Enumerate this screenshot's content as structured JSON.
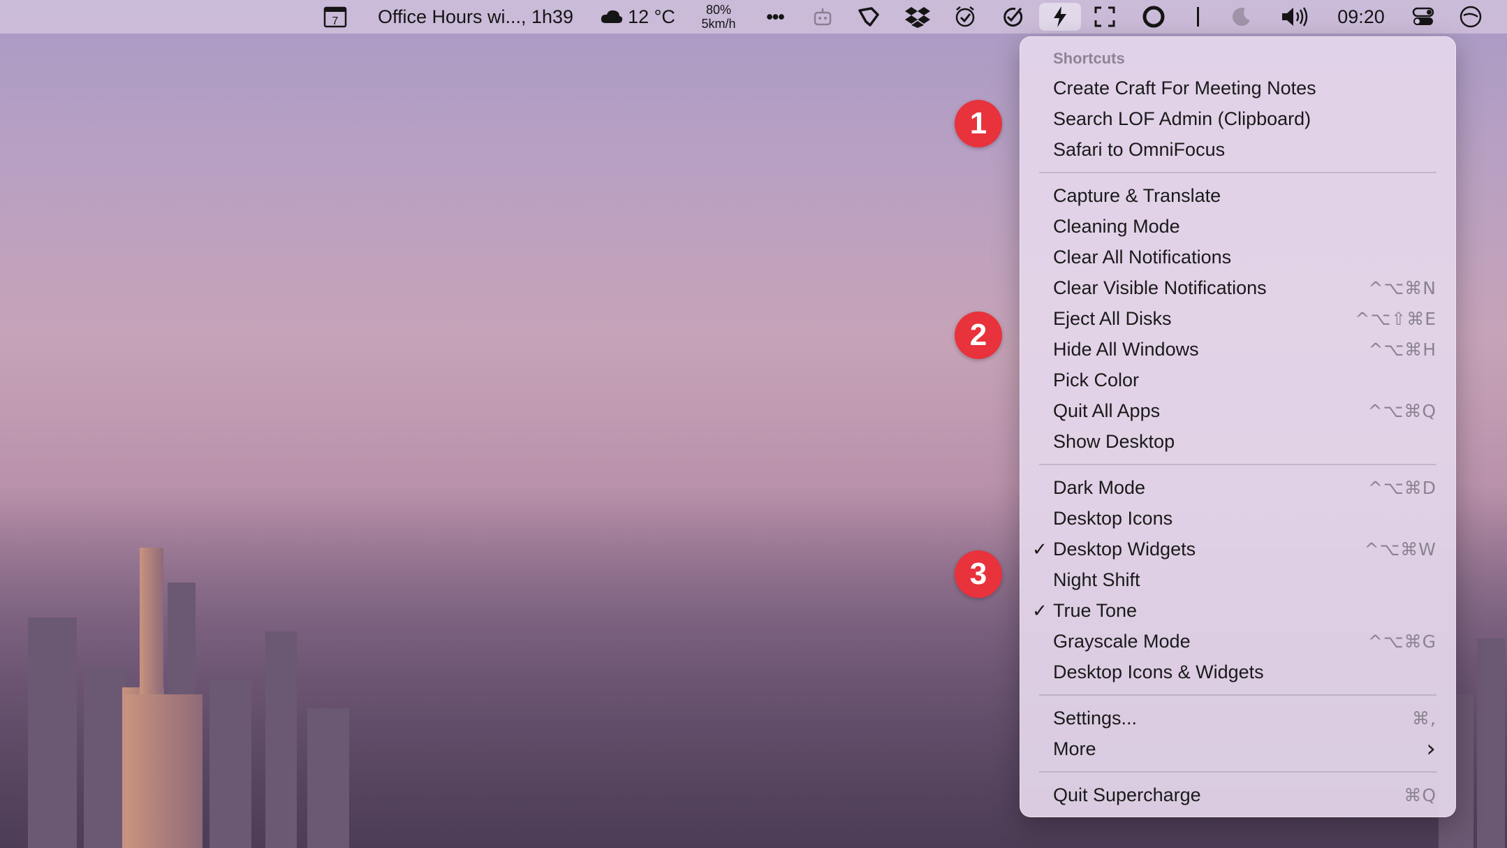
{
  "menubar": {
    "calendar_day": "7",
    "event": "Office Hours wi..., 1h39",
    "weather_temp": "12 °C",
    "humidity": "80%",
    "wind": "5km/h",
    "more": "•••",
    "clock": "09:20",
    "icons": [
      "calendar-icon",
      "cloud-icon",
      "more-icon",
      "bot-icon",
      "tag-icon",
      "dropbox-icon",
      "checkmark-circle-icon",
      "omnifocus-icon",
      "lightning-icon",
      "fullscreen-icon",
      "record-icon",
      "divider-icon",
      "moon-icon",
      "volume-icon",
      "control-center-icon",
      "timing-icon"
    ]
  },
  "menu": {
    "header": "Shortcuts",
    "group1": [
      {
        "label": "Create Craft For Meeting Notes"
      },
      {
        "label": "Search LOF Admin (Clipboard)"
      },
      {
        "label": "Safari to OmniFocus"
      }
    ],
    "group2": [
      {
        "label": "Capture & Translate",
        "shortcut": ""
      },
      {
        "label": "Cleaning Mode",
        "shortcut": ""
      },
      {
        "label": "Clear All Notifications",
        "shortcut": ""
      },
      {
        "label": "Clear Visible Notifications",
        "shortcut": "^⌥⌘N"
      },
      {
        "label": "Eject All Disks",
        "shortcut": "^⌥⇧⌘E"
      },
      {
        "label": "Hide All Windows",
        "shortcut": "^⌥⌘H"
      },
      {
        "label": "Pick Color",
        "shortcut": ""
      },
      {
        "label": "Quit All Apps",
        "shortcut": "^⌥⌘Q"
      },
      {
        "label": "Show Desktop",
        "shortcut": ""
      }
    ],
    "group3": [
      {
        "label": "Dark Mode",
        "shortcut": "^⌥⌘D",
        "checked": false
      },
      {
        "label": "Desktop Icons",
        "shortcut": "",
        "checked": false
      },
      {
        "label": "Desktop Widgets",
        "shortcut": "^⌥⌘W",
        "checked": true
      },
      {
        "label": "Night Shift",
        "shortcut": "",
        "checked": false
      },
      {
        "label": "True Tone",
        "shortcut": "",
        "checked": true
      },
      {
        "label": "Grayscale Mode",
        "shortcut": "^⌥⌘G",
        "checked": false
      },
      {
        "label": "Desktop Icons & Widgets",
        "shortcut": "",
        "checked": false
      }
    ],
    "group4": [
      {
        "label": "Settings...",
        "shortcut": "⌘,"
      },
      {
        "label": "More",
        "shortcut": "›"
      }
    ],
    "group5": [
      {
        "label": "Quit Supercharge",
        "shortcut": "⌘Q"
      }
    ],
    "check_glyph": "✓"
  },
  "annotations": [
    "1",
    "2",
    "3"
  ],
  "colors": {
    "badge": "#e8323c",
    "menu_bg": "#e4d6eb"
  }
}
